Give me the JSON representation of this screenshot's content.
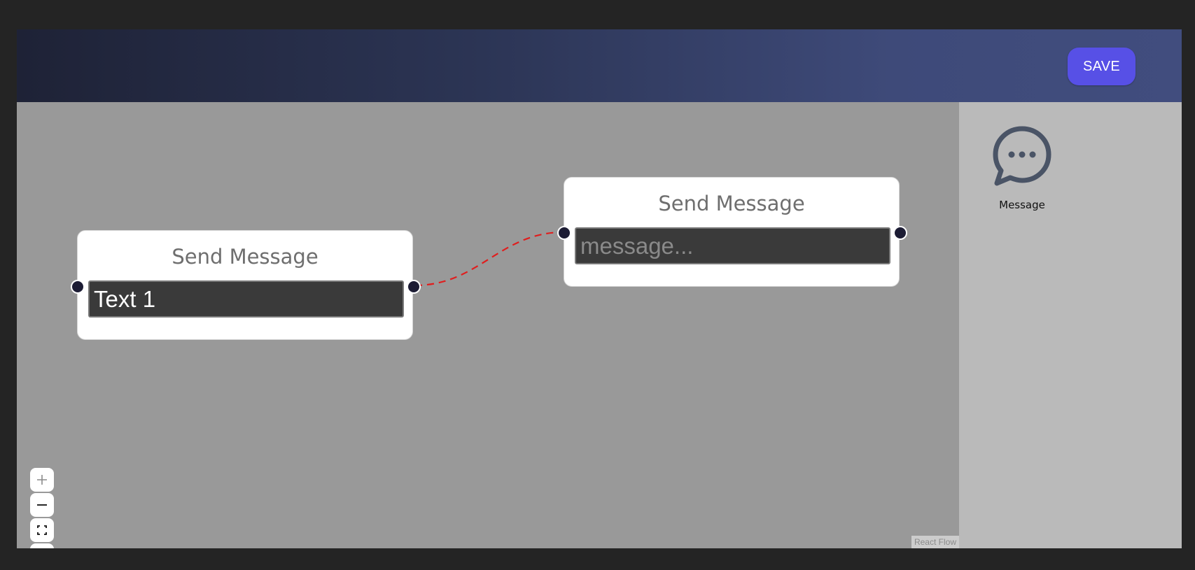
{
  "toolbar": {
    "save_label": "SAVE"
  },
  "flow": {
    "nodes": [
      {
        "title": "Send Message",
        "value": "Text 1",
        "placeholder": "message..."
      },
      {
        "title": "Send Message",
        "value": "",
        "placeholder": "message..."
      }
    ],
    "edge": {
      "style": "dashed",
      "color": "#e01e1e"
    },
    "attribution": "React Flow"
  },
  "controls": {
    "zoom_in_icon": "plus-icon",
    "zoom_out_icon": "minus-icon",
    "fit_view_icon": "fit-view-icon",
    "lock_icon": "unlock-icon"
  },
  "panel": {
    "items": [
      {
        "label": "Message",
        "icon": "chat-bubble-icon"
      }
    ]
  },
  "colors": {
    "accent": "#5750e6",
    "header_start": "#1e2236",
    "header_end": "#414d7e",
    "canvas": "#999999",
    "panel": "#bababa",
    "handle": "#1c1c34"
  }
}
